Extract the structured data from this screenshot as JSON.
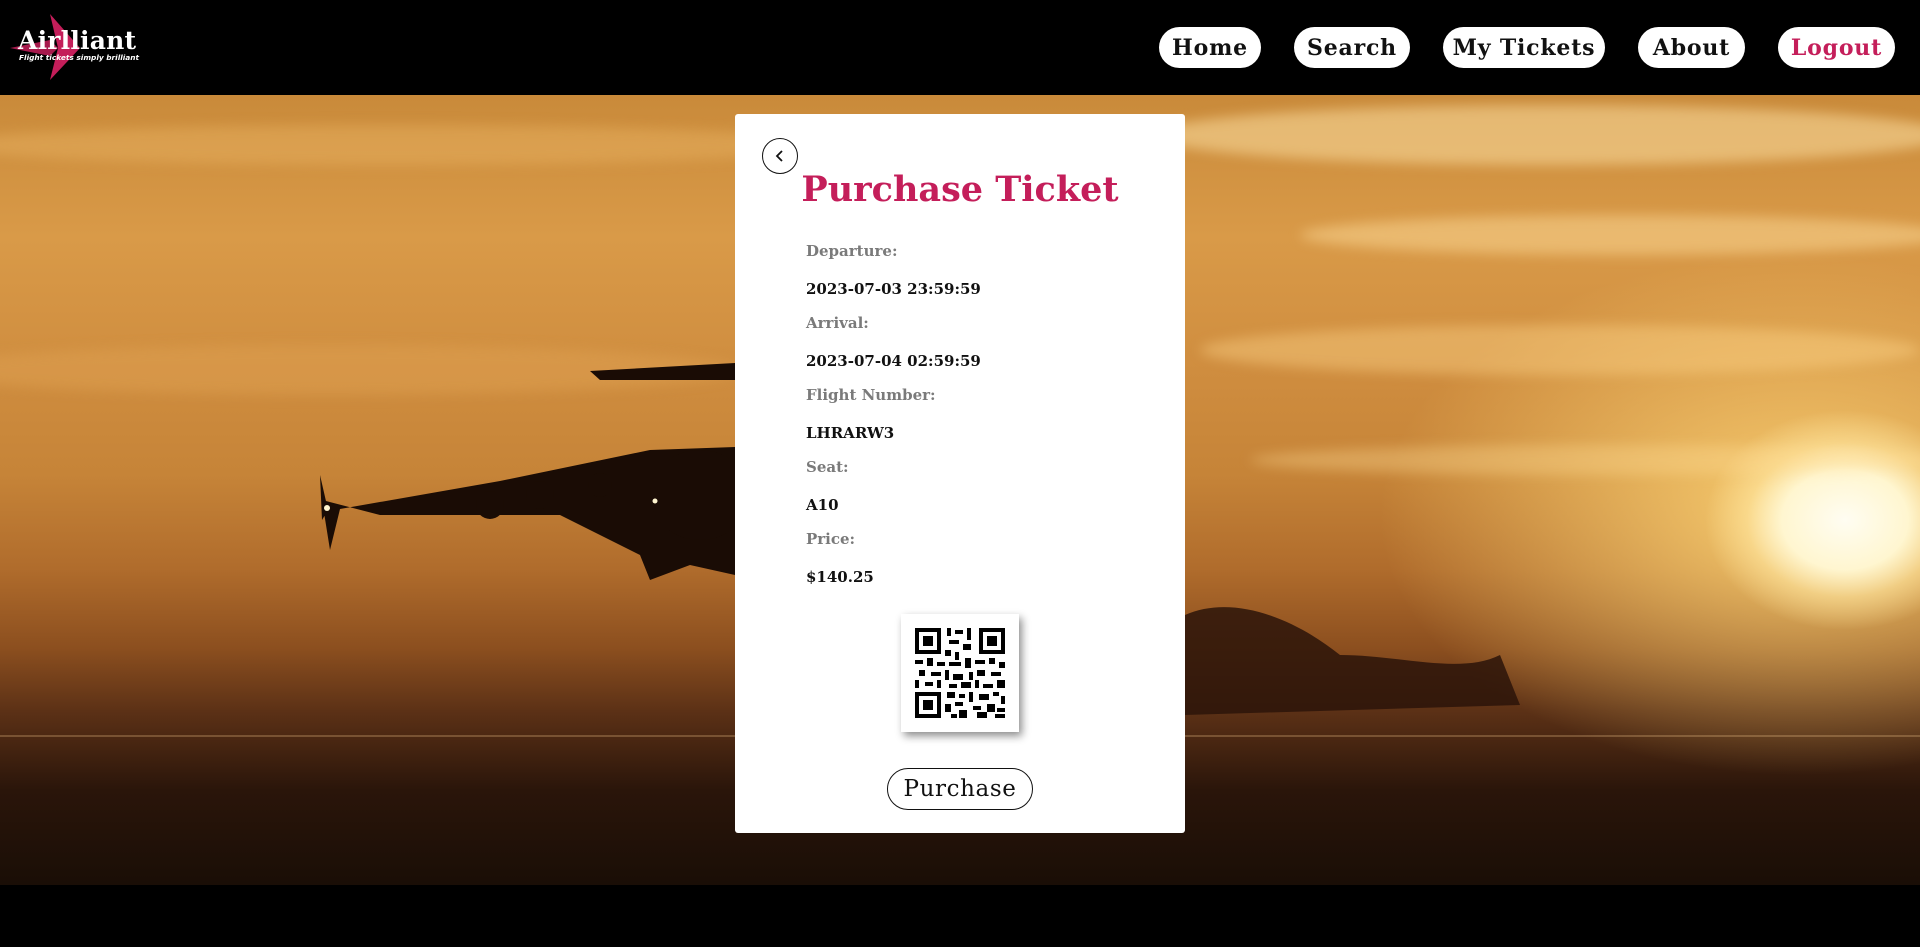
{
  "brand": {
    "name": "Airlliant",
    "tagline": "Flight tickets simply brilliant",
    "accent_color": "#c41e5a"
  },
  "nav": {
    "items": [
      {
        "label": "Home"
      },
      {
        "label": "Search"
      },
      {
        "label": "My Tickets"
      },
      {
        "label": "About"
      },
      {
        "label": "Logout",
        "color": "#c41e5a"
      }
    ]
  },
  "card": {
    "back_icon": "chevron-left-icon",
    "title": "Purchase Ticket",
    "fields": [
      {
        "label": "Departure:",
        "value": "2023-07-03 23:59:59"
      },
      {
        "label": "Arrival:",
        "value": "2023-07-04 02:59:59"
      },
      {
        "label": "Flight Number:",
        "value": "LHRARW3"
      },
      {
        "label": "Seat:",
        "value": "A10"
      },
      {
        "label": "Price:",
        "value": "$140.25"
      }
    ],
    "qr_icon": "qr-code-icon",
    "purchase_label": "Purchase"
  }
}
